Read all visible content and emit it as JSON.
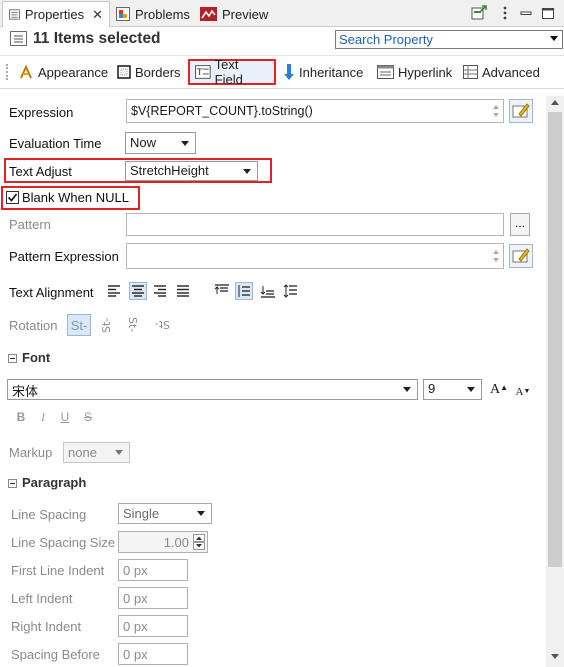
{
  "tabs": [
    {
      "label": "Properties",
      "icon": "properties-icon",
      "active": true
    },
    {
      "label": "Problems",
      "icon": "problems-icon"
    },
    {
      "label": "Preview",
      "icon": "preview-icon"
    }
  ],
  "header": {
    "title": "11 Items selected",
    "search_placeholder": "Search Property"
  },
  "section_tabs": [
    {
      "label": "Appearance",
      "icon": "appearance-icon"
    },
    {
      "label": "Borders",
      "icon": "borders-icon"
    },
    {
      "label": "Text Field",
      "icon": "text-field-icon",
      "selected": true
    },
    {
      "label": "Inheritance",
      "icon": "inheritance-icon"
    },
    {
      "label": "Hyperlink",
      "icon": "hyperlink-icon"
    },
    {
      "label": "Advanced",
      "icon": "advanced-icon"
    }
  ],
  "props": {
    "expression_label": "Expression",
    "expression_value": "$V{REPORT_COUNT}.toString()",
    "evaluation_time_label": "Evaluation Time",
    "evaluation_time_value": "Now",
    "text_adjust_label": "Text Adjust",
    "text_adjust_value": "StretchHeight",
    "blank_when_null_label": "Blank When NULL",
    "blank_when_null_checked": true,
    "pattern_label": "Pattern",
    "pattern_button": "...",
    "pattern_expression_label": "Pattern Expression",
    "text_alignment_label": "Text Alignment",
    "rotation_label": "Rotation",
    "rotation_glyph": "St-"
  },
  "font": {
    "section_label": "Font",
    "family": "宋体",
    "size": "9",
    "grow_glyph": "A",
    "shrink_glyph": "A",
    "bold_glyph": "B",
    "italic_glyph": "I",
    "underline_glyph": "U",
    "strike_glyph": "S",
    "markup_label": "Markup",
    "markup_value": "none"
  },
  "paragraph": {
    "section_label": "Paragraph",
    "line_spacing_label": "Line Spacing",
    "line_spacing_value": "Single",
    "line_spacing_size_label": "Line Spacing Size",
    "line_spacing_size_value": "1.00",
    "first_line_indent_label": "First Line Indent",
    "first_line_indent_value": "0 px",
    "left_indent_label": "Left Indent",
    "left_indent_value": "0 px",
    "right_indent_label": "Right Indent",
    "right_indent_value": "0 px",
    "spacing_before_label": "Spacing Before",
    "spacing_before_value": "0 px"
  },
  "colors": {
    "highlight_red": "#e02424",
    "accent_blue": "#1f5fbf",
    "selected_bg": "#dbe7f5"
  }
}
